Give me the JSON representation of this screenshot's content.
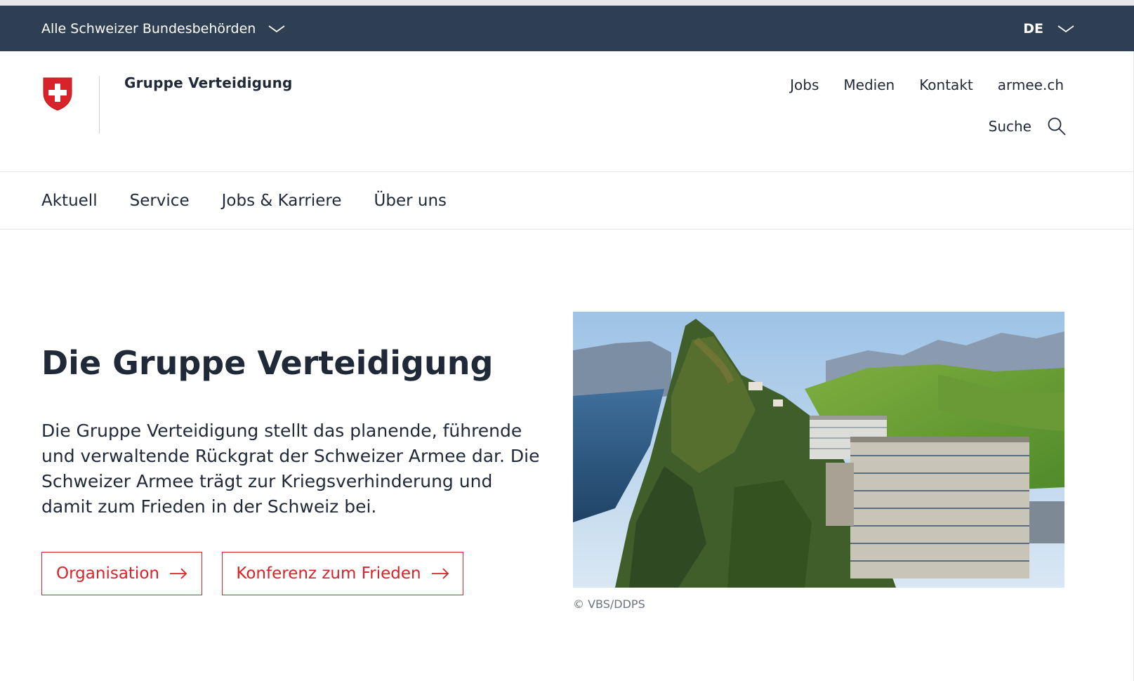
{
  "topbar": {
    "authorities_label": "Alle Schweizer Bundesbehörden",
    "language": "DE"
  },
  "header": {
    "org_name": "Gruppe Verteidigung",
    "meta_links": [
      "Jobs",
      "Medien",
      "Kontakt",
      "armee.ch"
    ],
    "search_label": "Suche"
  },
  "main_nav": [
    "Aktuell",
    "Service",
    "Jobs & Karriere",
    "Über uns"
  ],
  "hero": {
    "title": "Die Gruppe Verteidigung",
    "text": "Die Gruppe Verteidigung stellt das planende, führende und verwaltende Rückgrat der Schweizer Armee dar. Die Schweizer Armee trägt zur Kriegsverhinderung und damit zum Frieden in der Schweiz bei.",
    "buttons": [
      "Organisation",
      "Konferenz zum Frieden"
    ],
    "image_caption": "© VBS/DDPS"
  },
  "colors": {
    "topbar_bg": "#2e3f53",
    "accent_red": "#d8232a",
    "text": "#1f2937"
  }
}
